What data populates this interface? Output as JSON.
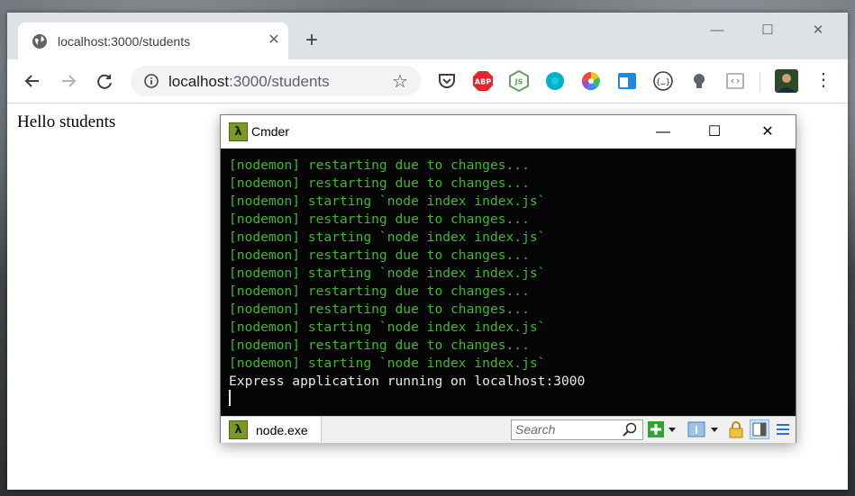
{
  "browser": {
    "tab_title": "localhost:3000/students",
    "tab_close": "✕",
    "new_tab": "+",
    "window_minimize": "—",
    "window_maximize": "☐",
    "window_close": "✕",
    "url_host": "localhost",
    "url_path": ":3000/students",
    "extensions": [
      {
        "name": "pocket-icon",
        "color": "#3c4043"
      },
      {
        "name": "adblock-icon",
        "label": "ABP",
        "color": "#e3262d"
      },
      {
        "name": "nodejs-icon",
        "label": "JS",
        "color": "#68a063"
      },
      {
        "name": "teal-circle-icon",
        "color": "#00b2c7"
      },
      {
        "name": "color-wheel-icon",
        "color": "#e84c8b"
      },
      {
        "name": "window-icon",
        "color": "#1e88e5"
      },
      {
        "name": "code-braces-icon",
        "label": "{…}",
        "color": "#3c4043"
      },
      {
        "name": "bulb-icon",
        "color": "#3c4043"
      },
      {
        "name": "source-view-icon",
        "color": "#9aa0a6"
      }
    ]
  },
  "page": {
    "heading": "Hello students"
  },
  "cmder": {
    "title": "Cmder",
    "lambda": "λ",
    "minimize": "—",
    "maximize": "☐",
    "close": "✕",
    "lines": [
      {
        "text": "[nodemon] restarting due to changes...",
        "color": "green"
      },
      {
        "text": "[nodemon] restarting due to changes...",
        "color": "green"
      },
      {
        "text": "[nodemon] starting `node index index.js`",
        "color": "green"
      },
      {
        "text": "[nodemon] restarting due to changes...",
        "color": "green"
      },
      {
        "text": "[nodemon] starting `node index index.js`",
        "color": "green"
      },
      {
        "text": "[nodemon] restarting due to changes...",
        "color": "green"
      },
      {
        "text": "[nodemon] starting `node index index.js`",
        "color": "green"
      },
      {
        "text": "[nodemon] restarting due to changes...",
        "color": "green"
      },
      {
        "text": "[nodemon] restarting due to changes...",
        "color": "green"
      },
      {
        "text": "[nodemon] starting `node index index.js`",
        "color": "green"
      },
      {
        "text": "[nodemon] restarting due to changes...",
        "color": "green"
      },
      {
        "text": "[nodemon] starting `node index index.js`",
        "color": "green"
      },
      {
        "text": "Express application running on localhost:3000",
        "color": "white"
      }
    ],
    "tab_label": "node.exe",
    "search_placeholder": "Search"
  }
}
